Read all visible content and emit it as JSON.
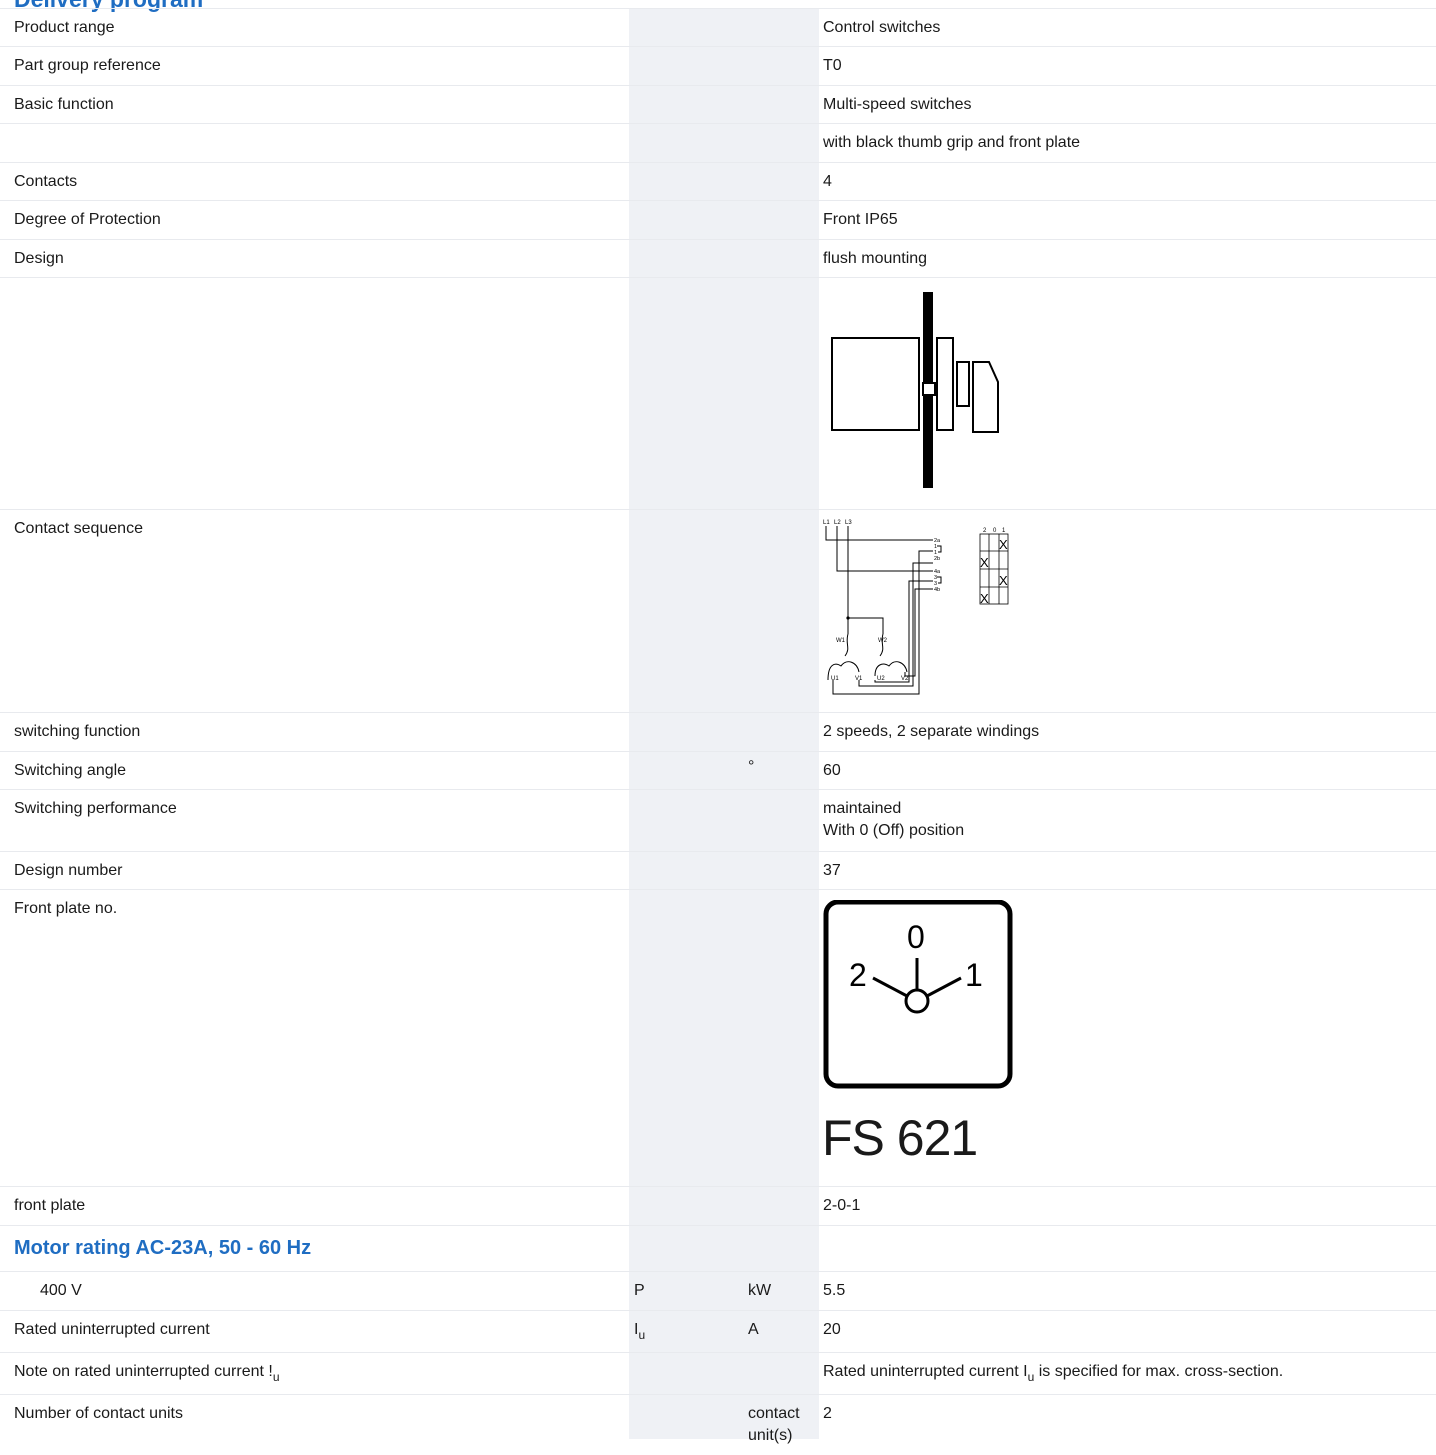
{
  "header": {
    "cut_title": "Delivery program"
  },
  "rows": {
    "product_range": {
      "label": "Product range",
      "value": "Control switches"
    },
    "part_group": {
      "label": "Part group reference",
      "value": "T0"
    },
    "basic_function": {
      "label": "Basic function",
      "value": "Multi-speed switches"
    },
    "basic_function_extra": {
      "value": "with black thumb grip and front plate"
    },
    "contacts": {
      "label": "Contacts",
      "value": "4"
    },
    "protection": {
      "label": "Degree of Protection",
      "value": "Front IP65"
    },
    "design": {
      "label": "Design",
      "value": "flush mounting"
    },
    "contact_sequence": {
      "label": "Contact sequence",
      "phases": [
        "L1",
        "L2",
        "L3"
      ],
      "terminals": [
        "2a",
        "1",
        "1",
        "2b",
        "4a",
        "3",
        "3",
        "4b"
      ],
      "positions": [
        "2",
        "0",
        "1"
      ],
      "windings": [
        "W1",
        "W2",
        "U1",
        "V1",
        "U2",
        "V2"
      ],
      "x_mark": "X"
    },
    "switching_function": {
      "label": "switching function",
      "value": "2 speeds, 2 separate windings"
    },
    "switching_angle": {
      "label": "Switching angle",
      "unit": "°",
      "value": "60"
    },
    "switching_performance": {
      "label": "Switching performance",
      "value_line1": "maintained",
      "value_line2": "With 0 (Off) position"
    },
    "design_number": {
      "label": "Design number",
      "value": "37"
    },
    "front_plate_no": {
      "label": "Front plate no.",
      "pos_top": "0",
      "pos_left": "2",
      "pos_right": "1",
      "plate_code": "FS 621"
    },
    "front_plate": {
      "label": "front plate",
      "value": "2-0-1"
    }
  },
  "section": {
    "title": "Motor rating AC-23A, 50 - 60 Hz"
  },
  "motor_rows": {
    "v400": {
      "label": "400 V",
      "symbol": "P",
      "unit": "kW",
      "value": "5.5"
    },
    "rated_current": {
      "label": "Rated uninterrupted current",
      "symbol": "I",
      "symbol_sub": "u",
      "unit": "A",
      "value": "20"
    },
    "note": {
      "label": "Note on rated uninterrupted current !",
      "label_sub": "u",
      "value_pre": "Rated uninterrupted current I",
      "value_sub": "u",
      "value_post": " is specified for max. cross-section."
    },
    "contact_units": {
      "label": "Number of contact units",
      "unit_line1": "contact",
      "unit_line2": "unit(s)",
      "value": "2"
    }
  }
}
